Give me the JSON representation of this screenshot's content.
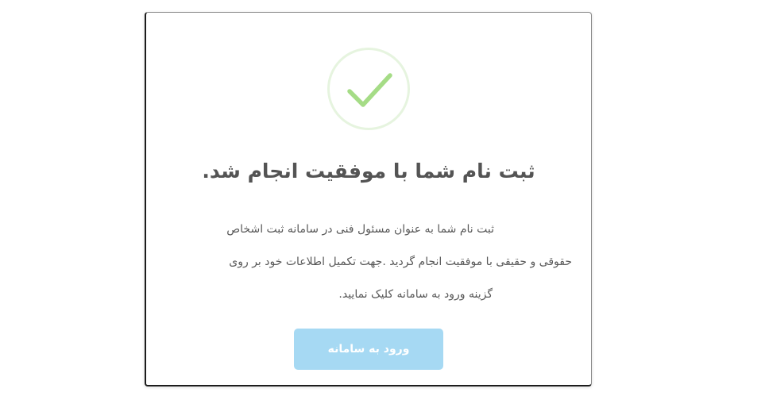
{
  "dialog": {
    "title": "ثبت نام شما با موفقیت انجام شد.",
    "message_lines": [
      "ثبت نام شما به عنوان مسئول فنی در سامانه ثبت اشخاص",
      "حقوقی و حقیقی با موفقیت انجام گردید .جهت تکمیل اطلاعات خود بر روی",
      "گزینه ورود به سامانه کلیک نمایید."
    ],
    "confirm_button_label": "ورود به سامانه",
    "success_icon": "check-circle-icon",
    "colors": {
      "success_green": "#a5dc86",
      "success_ring": "#e6f4df",
      "button_bg": "#a6d9f3",
      "title_text": "#545454",
      "body_text": "#595959"
    }
  }
}
